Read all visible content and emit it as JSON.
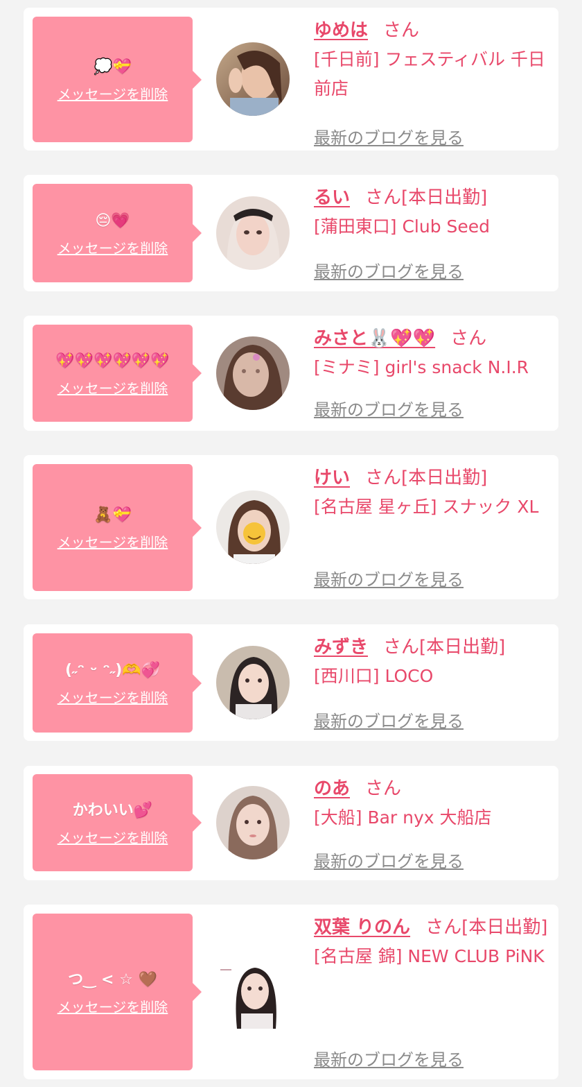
{
  "labels": {
    "delete": "メッセージを削除",
    "blog": "最新のブログを見る",
    "san": "さん"
  },
  "colors": {
    "bubble": "#fe93a4",
    "accent": "#e8486a",
    "link_gray": "#8a8a8a",
    "background": "#f3f3f3"
  },
  "entries": [
    {
      "message": "💭💝",
      "name": "ゆめは",
      "status": "",
      "shop": "[千日前] フェスティバル 千日前店"
    },
    {
      "message": "😔💗",
      "name": "るい",
      "status": "[本日出勤]",
      "shop": "[蒲田東口] Club Seed"
    },
    {
      "message": "💖💖💖💖💖💖",
      "name": "みさと🐰💖💖",
      "status": "",
      "shop": "[ミナミ] girl's snack N.I.R"
    },
    {
      "message": "🧸💝",
      "name": "けい",
      "status": "[本日出勤]",
      "shop": "[名古屋 星ヶ丘] スナック XL"
    },
    {
      "message": "(˶ᵔ ᵕ ᵔ˶)🫶💞",
      "name": "みずき",
      "status": "[本日出勤]",
      "shop": "[西川口] LOCO"
    },
    {
      "message": "かわいい💕",
      "name": "のあ",
      "status": "",
      "shop": "[大船] Bar nyx 大船店"
    },
    {
      "message": "つ‿ < ☆ 🤎",
      "name": "双葉 りのん",
      "status": "[本日出勤]",
      "shop": "[名古屋 錦] NEW CLUB PiNK"
    }
  ]
}
